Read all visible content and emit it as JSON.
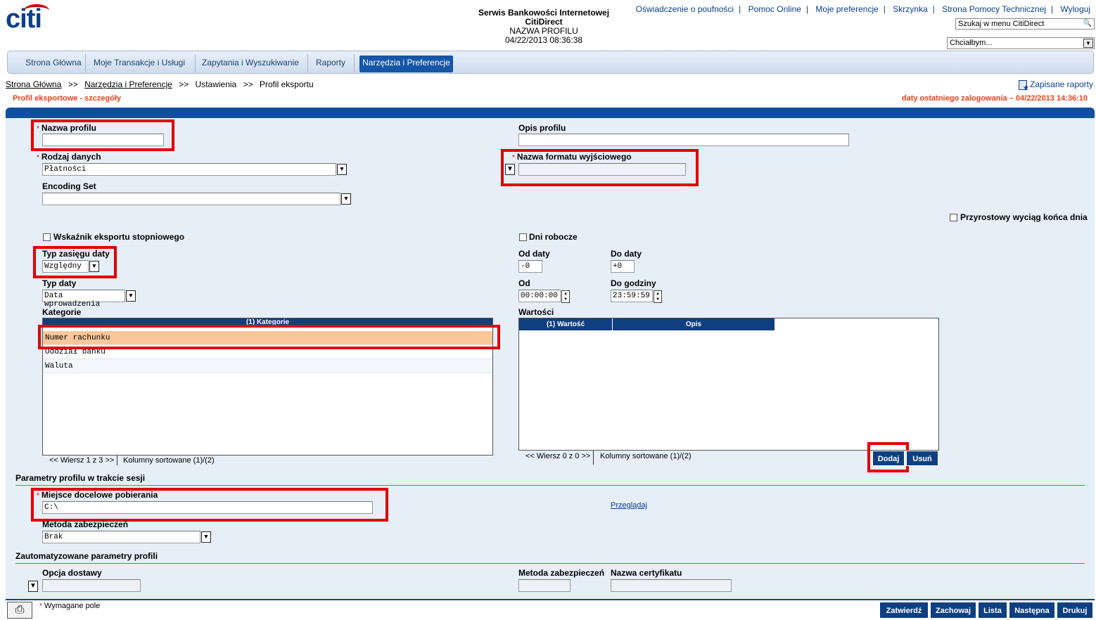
{
  "header": {
    "logo": "citi",
    "service_title": "Serwis Bankowości Internetowej",
    "service_subtitle": "CitiDirect",
    "profile_name": "NAZWA PROFILU",
    "datetime": "04/22/2013 08:36:38",
    "links": [
      "Oświadczenie o poufności",
      "Pomoc Online",
      "Moje preferencje",
      "Skrzynka",
      "Strona Pomocy Technicznej",
      "Wyloguj"
    ],
    "search_placeholder": "Szukaj w menu CitiDirect",
    "want_select": "Chciałbym..."
  },
  "nav": {
    "tabs": [
      "Strona Główna",
      "Moje Transakcje i Usługi",
      "Zapytania i Wyszukiwanie",
      "Raporty",
      "Narzędzia i Preferencje"
    ],
    "active": "Narzędzia i Preferencje"
  },
  "breadcrumb": {
    "items": [
      "Strona Główna",
      "Narzędzia i Preferencje",
      "Ustawienia",
      "Profil eksportu"
    ],
    "sep": ">>"
  },
  "page": {
    "subtitle": "Profil eksportowe - szczegóły",
    "last_login": "daty ostatniego zalogowania – 04/22/2013 14:36:10",
    "saved_reports": "Zapisane raporty"
  },
  "form": {
    "required_mark": "*",
    "profile_name_label": "Nazwa profilu",
    "profile_name_value": "",
    "profile_desc_label": "Opis profilu",
    "profile_desc_value": "",
    "data_type_label": "Rodzaj danych",
    "data_type_value": "Płatności",
    "output_format_label": "Nazwa formatu wyjściowego",
    "output_format_value": "",
    "encoding_label": "Encoding Set",
    "encoding_value": "",
    "incremental_label": "Przyrostowy wyciąg końca dnia",
    "stage_export_label": "Wskaźnik eksportu stopniowego",
    "workdays_label": "Dni robocze",
    "date_range_type_label": "Typ zasięgu daty",
    "date_range_type_value": "Względny",
    "from_date_label": "Od daty",
    "from_date_value": "-0",
    "to_date_label": "Do daty",
    "to_date_value": "+0",
    "date_type_label": "Typ daty",
    "date_type_value": "Data wprowadzenia",
    "from_time_label": "Od",
    "from_time_value": "00:00:00",
    "to_time_label": "Do godziny",
    "to_time_value": "23:59:59"
  },
  "categories": {
    "label": "Kategorie",
    "header": "(1) Kategorie",
    "rows": [
      "Numer rachunku",
      "Oddział banku",
      "Waluta"
    ],
    "selected": 0,
    "pager": "<< Wiersz 1 z 3 >>",
    "sorted": "Kolumny sortowane (1)/(2)"
  },
  "values": {
    "label": "Wartości",
    "headers": [
      "(1) Wartość",
      "Opis"
    ],
    "pager": "<< Wiersz 0 z 0 >>",
    "sorted": "Kolumny sortowane (1)/(2)",
    "add": "Dodaj",
    "remove": "Usuń"
  },
  "session": {
    "title": "Parametry profilu w trakcie sesji",
    "dest_label": "Miejsce docelowe pobierania",
    "dest_value": "C:\\",
    "browse": "Przeglądaj",
    "security_label": "Metoda zabezpieczeń",
    "security_value": "Brak"
  },
  "auto": {
    "title": "Zautomatyzowane parametry profili",
    "delivery_label": "Opcja dostawy",
    "security_label": "Metoda zabezpieczeń",
    "cert_label": "Nazwa certyfikatu"
  },
  "footer": {
    "required_note": "Wymagane pole",
    "buttons": [
      "Zatwierdź",
      "Zachowaj",
      "Lista",
      "Następna",
      "Drukuj"
    ]
  }
}
